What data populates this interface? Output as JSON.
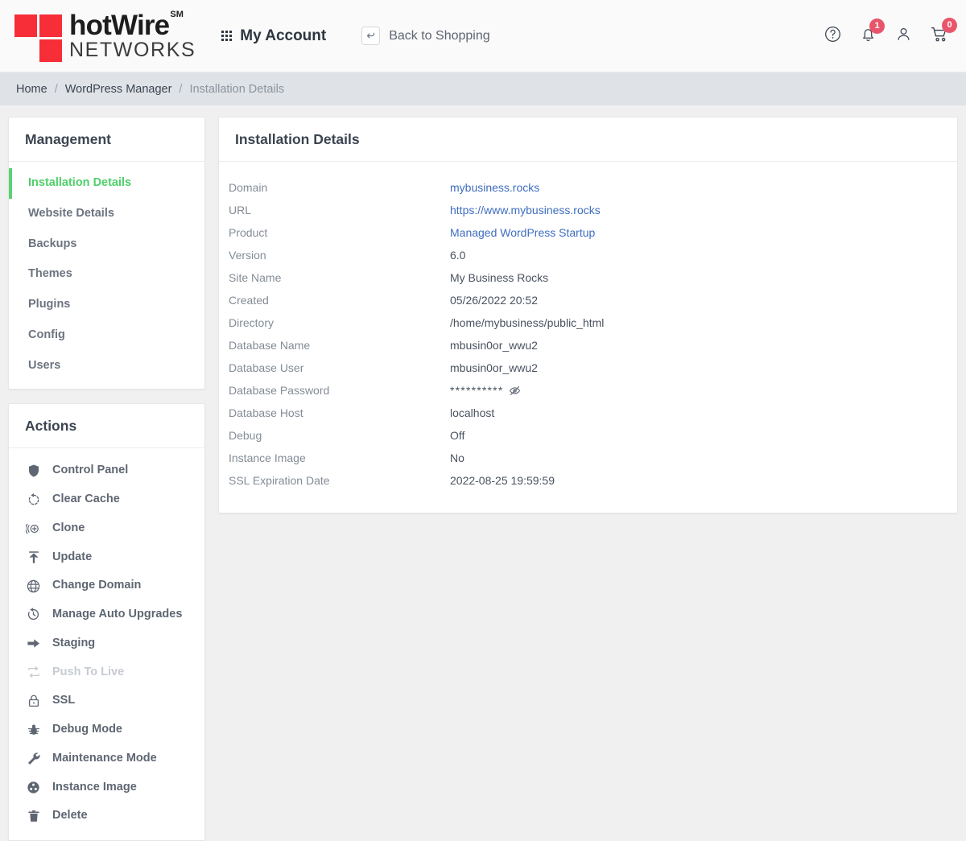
{
  "brand": {
    "name_main": "hotWire",
    "trademark": "SM",
    "name_sub": "NETWORKS",
    "square_color": "#f72d37"
  },
  "topbar": {
    "my_account_label": "My Account",
    "my_account_icon": "grid-icon",
    "back_to_shopping_label": "Back to Shopping",
    "back_icon": "enter-return-icon",
    "help_icon": "question-circle-icon",
    "notifications_icon": "bell-icon",
    "notifications_count": "1",
    "account_icon": "user-icon",
    "cart_icon": "shopping-cart-icon",
    "cart_count": "0",
    "badge_color": "#e8556a"
  },
  "breadcrumb": {
    "items": [
      {
        "label": "Home",
        "current": false
      },
      {
        "label": "WordPress Manager",
        "current": false
      },
      {
        "label": "Installation Details",
        "current": true
      }
    ],
    "separator": "/"
  },
  "sidebar": {
    "management": {
      "title": "Management",
      "active_color": "#4fd06a",
      "items": [
        {
          "label": "Installation Details",
          "active": true
        },
        {
          "label": "Website Details",
          "active": false
        },
        {
          "label": "Backups",
          "active": false
        },
        {
          "label": "Themes",
          "active": false
        },
        {
          "label": "Plugins",
          "active": false
        },
        {
          "label": "Config",
          "active": false
        },
        {
          "label": "Users",
          "active": false
        }
      ]
    },
    "actions": {
      "title": "Actions",
      "items": [
        {
          "label": "Control Panel",
          "icon": "shield-icon",
          "disabled": false
        },
        {
          "label": "Clear Cache",
          "icon": "refresh-dashed-icon",
          "disabled": false
        },
        {
          "label": "Clone",
          "icon": "clone-plus-icon",
          "disabled": false
        },
        {
          "label": "Update",
          "icon": "upload-arrow-icon",
          "disabled": false
        },
        {
          "label": "Change Domain",
          "icon": "globe-icon",
          "disabled": false
        },
        {
          "label": "Manage Auto Upgrades",
          "icon": "history-clock-icon",
          "disabled": false
        },
        {
          "label": "Staging",
          "icon": "arrow-right-icon",
          "disabled": false
        },
        {
          "label": "Push To Live",
          "icon": "push-loop-icon",
          "disabled": true
        },
        {
          "label": "SSL",
          "icon": "lock-icon",
          "disabled": false
        },
        {
          "label": "Debug Mode",
          "icon": "bug-icon",
          "disabled": false
        },
        {
          "label": "Maintenance Mode",
          "icon": "wrench-icon",
          "disabled": false
        },
        {
          "label": "Instance Image",
          "icon": "film-reel-icon",
          "disabled": false
        },
        {
          "label": "Delete",
          "icon": "trash-icon",
          "disabled": false
        }
      ]
    }
  },
  "main": {
    "title": "Installation Details",
    "rows": [
      {
        "label": "Domain",
        "value": "mybusiness.rocks",
        "kind": "link"
      },
      {
        "label": "URL",
        "value": "https://www.mybusiness.rocks",
        "kind": "link"
      },
      {
        "label": "Product",
        "value": "Managed WordPress Startup",
        "kind": "link"
      },
      {
        "label": "Version",
        "value": "6.0",
        "kind": "text"
      },
      {
        "label": "Site Name",
        "value": "My Business Rocks",
        "kind": "text"
      },
      {
        "label": "Created",
        "value": "05/26/2022 20:52",
        "kind": "text"
      },
      {
        "label": "Directory",
        "value": "/home/mybusiness/public_html",
        "kind": "text"
      },
      {
        "label": "Database Name",
        "value": "mbusin0or_wwu2",
        "kind": "text"
      },
      {
        "label": "Database User",
        "value": "mbusin0or_wwu2",
        "kind": "text"
      },
      {
        "label": "Database Password",
        "value": "**********",
        "kind": "password"
      },
      {
        "label": "Database Host",
        "value": "localhost",
        "kind": "text"
      },
      {
        "label": "Debug",
        "value": "Off",
        "kind": "text"
      },
      {
        "label": "Instance Image",
        "value": "No",
        "kind": "text"
      },
      {
        "label": "SSL Expiration Date",
        "value": "2022-08-25 19:59:59",
        "kind": "text"
      }
    ],
    "password_toggle_icon": "eye-slash-icon",
    "link_color": "#3f6dc0"
  }
}
